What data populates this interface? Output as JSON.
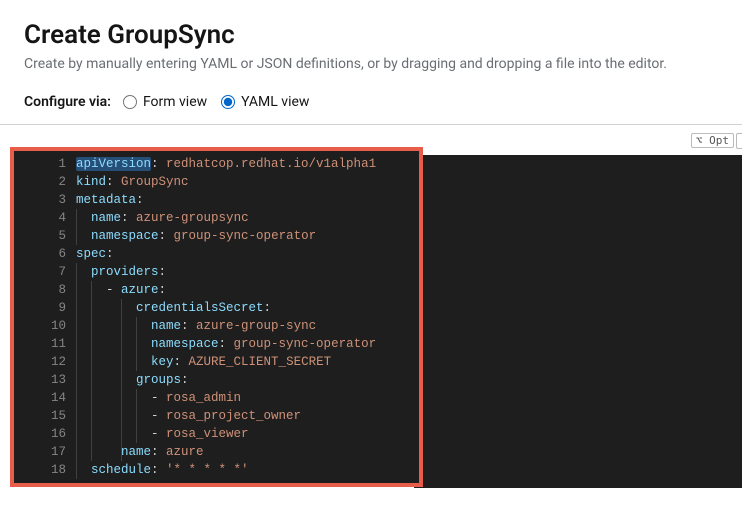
{
  "header": {
    "title": "Create GroupSync",
    "subtitle": "Create by manually entering YAML or JSON definitions, or by dragging and dropping a file into the editor."
  },
  "config": {
    "label": "Configure via:",
    "form_view": "Form view",
    "yaml_view": "YAML view"
  },
  "opt_button": "⌥ Opt",
  "code": {
    "line_numbers": [
      "1",
      "2",
      "3",
      "4",
      "5",
      "6",
      "7",
      "8",
      "9",
      "10",
      "11",
      "12",
      "13",
      "14",
      "15",
      "16",
      "17",
      "18"
    ],
    "l1_k": "apiVersion",
    "l1_v": "redhatcop.redhat.io/v1alpha1",
    "l2_k": "kind",
    "l2_v": "GroupSync",
    "l3_k": "metadata",
    "l4_k": "name",
    "l4_v": "azure-groupsync",
    "l5_k": "namespace",
    "l5_v": "group-sync-operator",
    "l6_k": "spec",
    "l7_k": "providers",
    "l8_k": "azure",
    "l9_k": "credentialsSecret",
    "l10_k": "name",
    "l10_v": "azure-group-sync",
    "l11_k": "namespace",
    "l11_v": "group-sync-operator",
    "l12_k": "key",
    "l12_v": "AZURE_CLIENT_SECRET",
    "l13_k": "groups",
    "l14_v": "rosa_admin",
    "l15_v": "rosa_project_owner",
    "l16_v": "rosa_viewer",
    "l17_k": "name",
    "l17_v": "azure",
    "l18_k": "schedule",
    "l18_v": "'* * * * *'"
  }
}
